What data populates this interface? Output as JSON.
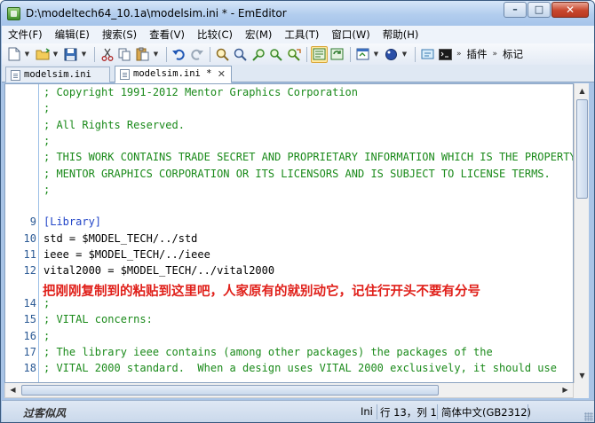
{
  "window": {
    "title": "D:\\modeltech64_10.1a\\modelsim.ini * - EmEditor",
    "minimize_glyph": "–",
    "maximize_glyph": "□",
    "close_glyph": "✕"
  },
  "menu": [
    "文件(F)",
    "编辑(E)",
    "搜索(S)",
    "查看(V)",
    "比较(C)",
    "宏(M)",
    "工具(T)",
    "窗口(W)",
    "帮助(H)"
  ],
  "toolbar": {
    "plugins_label": "插件",
    "markers_label": "标记"
  },
  "tabs": [
    {
      "label": "modelsim.ini",
      "active": false
    },
    {
      "label": "modelsim.ini *",
      "active": true,
      "close": "✕"
    }
  ],
  "editor": {
    "lines": [
      {
        "num": "",
        "text": "; Copyright 1991-2012 Mentor Graphics Corporation",
        "kind": "comment"
      },
      {
        "num": "",
        "text": ";",
        "kind": "comment"
      },
      {
        "num": "",
        "text": "; All Rights Reserved.",
        "kind": "comment"
      },
      {
        "num": "",
        "text": ";",
        "kind": "comment"
      },
      {
        "num": "",
        "text": "; THIS WORK CONTAINS TRADE SECRET AND PROPRIETARY INFORMATION WHICH IS THE PROPERTY OF",
        "kind": "comment"
      },
      {
        "num": "",
        "text": "; MENTOR GRAPHICS CORPORATION OR ITS LICENSORS AND IS SUBJECT TO LICENSE TERMS.",
        "kind": "comment"
      },
      {
        "num": "",
        "text": ";",
        "kind": "comment"
      },
      {
        "num": "",
        "text": "",
        "kind": "plain"
      },
      {
        "num": "9",
        "text": "[Library]",
        "kind": "section"
      },
      {
        "num": "10",
        "text": "std = $MODEL_TECH/../std",
        "kind": "plain"
      },
      {
        "num": "11",
        "text": "ieee = $MODEL_TECH/../ieee",
        "kind": "plain"
      },
      {
        "num": "12",
        "text": "vital2000 = $MODEL_TECH/../vital2000",
        "kind": "plain"
      },
      {
        "num": "",
        "text": "",
        "kind": "plain"
      },
      {
        "num": "14",
        "text": ";",
        "kind": "comment"
      },
      {
        "num": "15",
        "text": "; VITAL concerns:",
        "kind": "comment"
      },
      {
        "num": "16",
        "text": ";",
        "kind": "comment"
      },
      {
        "num": "17",
        "text": "; The library ieee contains (among other packages) the packages of the",
        "kind": "comment"
      },
      {
        "num": "18",
        "text": "; VITAL 2000 standard.  When a design uses VITAL 2000 exclusively, it should use",
        "kind": "comment"
      }
    ],
    "annotation": "把刚刚复制到的粘贴到这里吧，人家原有的就别动它，记住行开头不要有分号"
  },
  "status": {
    "left_text": "过客似风",
    "mode": "Ini",
    "position": "行 13，列 1",
    "encoding": "简体中文(GB2312)"
  }
}
